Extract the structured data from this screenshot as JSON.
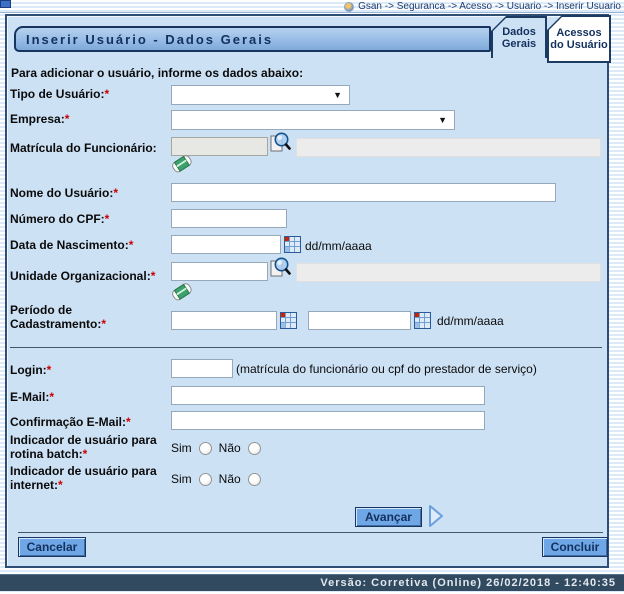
{
  "colors": {
    "panel_blue": "#cde1f5",
    "button_blue": "#6fa7e6",
    "footer_navy": "#324a60",
    "title_text_navy": "#13305e",
    "required_red": "#cc0000"
  },
  "ui": {
    "required_marker": "*",
    "select_arrow": "▼"
  },
  "breadcrumb": {
    "path": "Gsan -> Seguranca -> Acesso -> Usuario -> Inserir Usuario"
  },
  "header": {
    "title": "Inserir Usuário - Dados Gerais"
  },
  "tabs": {
    "dados_gerais": "Dados Gerais",
    "acessos_usuario": "Acessos do Usuário"
  },
  "form": {
    "intro": "Para adicionar o usuário, informe os dados abaixo:",
    "fields": {
      "tipo_usuario": {
        "label": "Tipo de Usuário:",
        "required": true,
        "value": ""
      },
      "empresa": {
        "label": "Empresa:",
        "required": true,
        "value": ""
      },
      "matricula": {
        "label": "Matrícula do Funcionário:",
        "required": false,
        "value": "",
        "display_name": ""
      },
      "nome": {
        "label": "Nome do Usuário:",
        "required": true,
        "value": ""
      },
      "cpf": {
        "label": "Número do CPF:",
        "required": true,
        "value": ""
      },
      "nascimento": {
        "label": "Data de Nascimento:",
        "required": true,
        "value": "",
        "hint": "dd/mm/aaaa"
      },
      "unidade": {
        "label": "Unidade Organizacional:",
        "required": true,
        "value": "",
        "display_name": ""
      },
      "periodo": {
        "label": "Período de Cadastramento:",
        "required": true,
        "value_start": "",
        "value_end": "",
        "hint": "dd/mm/aaaa"
      },
      "login": {
        "label": "Login:",
        "required": true,
        "value": "",
        "hint": "(matrícula do funcionário ou cpf do prestador de serviço)"
      },
      "email": {
        "label": "E-Mail:",
        "required": true,
        "value": ""
      },
      "email_confirm": {
        "label": "Confirmação E-Mail:",
        "required": true,
        "value": ""
      },
      "batch": {
        "label": "Indicador de usuário para rotina batch:",
        "required": true,
        "options": {
          "yes": "Sim",
          "no": "Não"
        },
        "selected": ""
      },
      "internet": {
        "label": "Indicador de usuário para internet:",
        "required": true,
        "options": {
          "yes": "Sim",
          "no": "Não"
        },
        "selected": ""
      }
    }
  },
  "buttons": {
    "avancar": "Avançar",
    "cancelar": "Cancelar",
    "concluir": "Concluir"
  },
  "footer": {
    "version": "Versão: Corretiva (Online) 26/02/2018 - 12:40:35"
  }
}
